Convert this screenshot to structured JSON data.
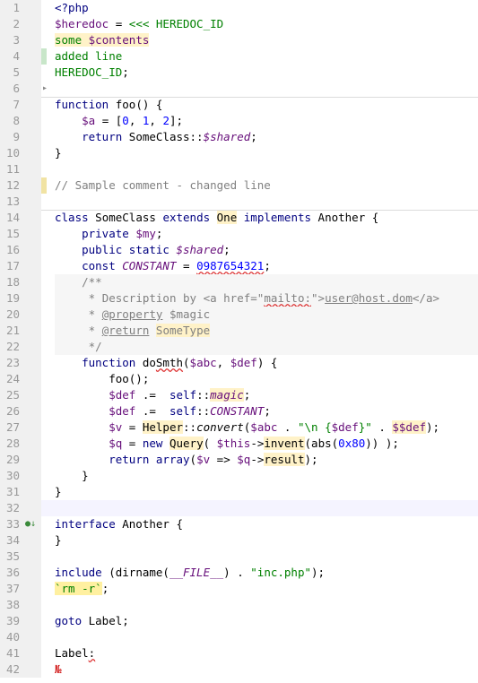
{
  "editor": {
    "line_numbers": [
      "1",
      "2",
      "3",
      "4",
      "5",
      "6",
      "7",
      "8",
      "9",
      "10",
      "11",
      "12",
      "13",
      "14",
      "15",
      "16",
      "17",
      "18",
      "19",
      "20",
      "21",
      "22",
      "23",
      "24",
      "25",
      "26",
      "27",
      "28",
      "29",
      "30",
      "31",
      "32",
      "33",
      "34",
      "35",
      "36",
      "37",
      "38",
      "39",
      "40",
      "41",
      "42"
    ],
    "lines": [
      "<?php",
      "$heredoc = <<< HEREDOC_ID",
      "some $contents",
      "added line",
      "HEREDOC_ID;",
      "",
      "function foo() {",
      "    $a = [0, 1, 2];",
      "    return SomeClass::$shared;",
      "}",
      "",
      "// Sample comment - changed line",
      "",
      "class SomeClass extends One implements Another {",
      "    private $my;",
      "    public static $shared;",
      "    const CONSTANT = 0987654321;",
      "    /**",
      "     * Description by <a href=\"mailto:\">user@host.dom</a>",
      "     * @property $magic",
      "     * @return SomeType",
      "     */",
      "    function doSmth($abc, $def) {",
      "        foo();",
      "        $def .=  self::magic;",
      "        $def .=  self::CONSTANT;",
      "        $v = Helper::convert($abc . \"\\n {$def}\" . $$def);",
      "        $q = new Query( $this->invent(abs(0x80)) );",
      "        return array($v => $q->result);",
      "    }",
      "}",
      "",
      "interface Another {",
      "}",
      "",
      "include (dirname(__FILE__) . \"inc.php\");",
      "`rm -r`;",
      "",
      "goto Label;",
      "",
      "Label:",
      "№"
    ]
  },
  "colors": {
    "gutter_bg": "#f0f0f0",
    "keyword": "#000080",
    "string": "#008000",
    "number": "#0000ff",
    "variable": "#660e7a",
    "comment": "#808080",
    "added_marker": "#c8e6c9",
    "changed_marker": "#f1e3a3"
  },
  "icons": [
    "fold-arrow-icon",
    "implementation-marker-icon"
  ]
}
